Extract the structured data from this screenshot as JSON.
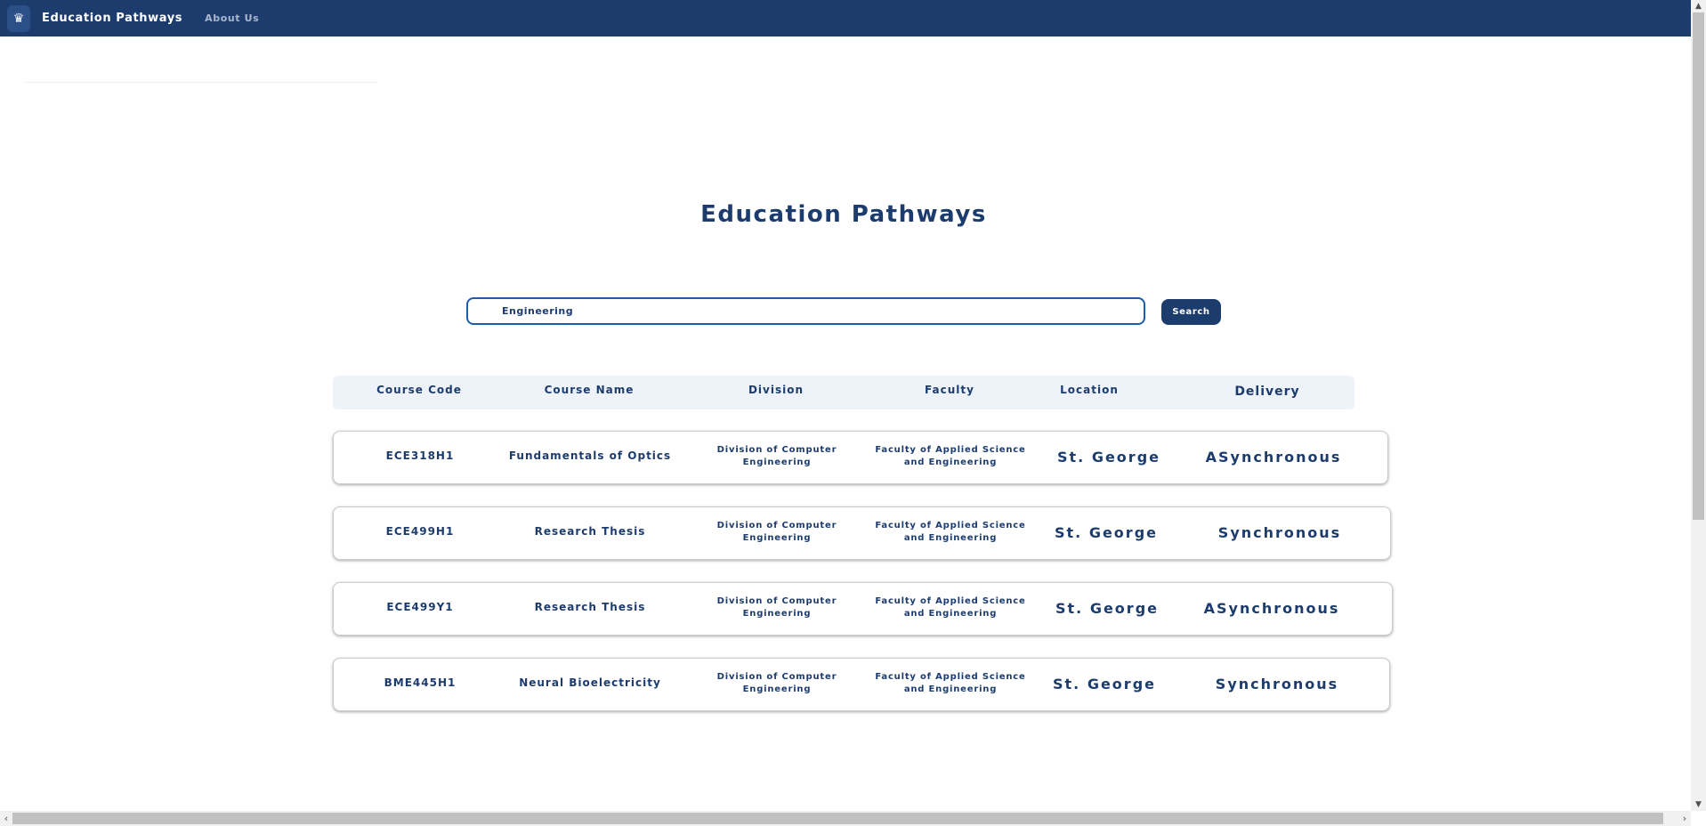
{
  "navbar": {
    "brand": "Education Pathways",
    "about": "About Us",
    "logo_icon": "university-crest-icon"
  },
  "page": {
    "title": "Education Pathways"
  },
  "search": {
    "value": "Engineering",
    "button_label": "Search"
  },
  "table": {
    "headers": [
      "Course Code",
      "Course Name",
      "Division",
      "Faculty",
      "Location",
      "Delivery"
    ],
    "rows": [
      {
        "code": "ECE318H1",
        "name": "Fundamentals of Optics",
        "division": "Division of Computer Engineering",
        "faculty": "Faculty of Applied Science and Engineering",
        "location": "St. George",
        "delivery": "ASynchronous"
      },
      {
        "code": "ECE499H1",
        "name": "Research Thesis",
        "division": "Division of Computer Engineering",
        "faculty": "Faculty of Applied Science and Engineering",
        "location": "St. George",
        "delivery": "Synchronous"
      },
      {
        "code": "ECE499Y1",
        "name": "Research Thesis",
        "division": "Division of Computer Engineering",
        "faculty": "Faculty of Applied Science and Engineering",
        "location": "St. George",
        "delivery": "ASynchronous"
      },
      {
        "code": "BME445H1",
        "name": "Neural Bioelectricity",
        "division": "Division of Computer Engineering",
        "faculty": "Faculty of Applied Science and Engineering",
        "location": "St. George",
        "delivery": "Synchronous"
      }
    ]
  },
  "colors": {
    "primary": "#1d3c6e",
    "header_bg": "#eef3fa",
    "input_border": "#1d5ca8"
  }
}
